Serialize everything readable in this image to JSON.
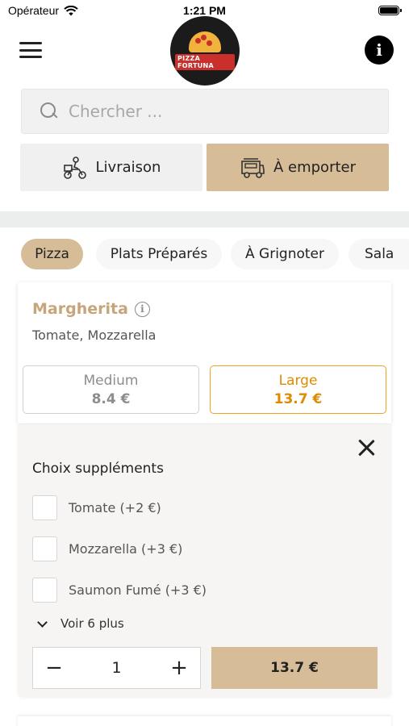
{
  "status_bar": {
    "carrier": "Opérateur",
    "time": "1:21 PM",
    "battery_level": 1.0
  },
  "header": {
    "logo_text": "PIZZA FORTUNA",
    "info_label": "i"
  },
  "search": {
    "placeholder": "Chercher ..."
  },
  "modes": {
    "delivery_label": "Livraison",
    "takeaway_label": "À emporter",
    "selected": "À emporter"
  },
  "categories": [
    {
      "label": "Pizza",
      "active": true
    },
    {
      "label": "Plats Préparés",
      "active": false
    },
    {
      "label": "À Grignoter",
      "active": false
    },
    {
      "label": "Sala",
      "active": false
    }
  ],
  "product": {
    "name": "Margherita",
    "description": "Tomate, Mozzarella",
    "sizes": [
      {
        "name": "Medium",
        "price": "8.4 €",
        "selected": false
      },
      {
        "name": "Large",
        "price": "13.7 €",
        "selected": true
      }
    ]
  },
  "supplements": {
    "title": "Choix suppléments",
    "options": [
      {
        "label": "Tomate (+2 €)",
        "checked": false
      },
      {
        "label": "Mozzarella (+3 €)",
        "checked": false
      },
      {
        "label": "Saumon Fumé (+3 €)",
        "checked": false
      }
    ],
    "see_more": "Voir 6 plus"
  },
  "order": {
    "minus": "−",
    "plus": "+",
    "quantity": "1",
    "total": "13.7 €"
  },
  "colors": {
    "accent": "#d6bd98",
    "product_name": "#c6a57a",
    "selected_size": "#f0a21c"
  }
}
